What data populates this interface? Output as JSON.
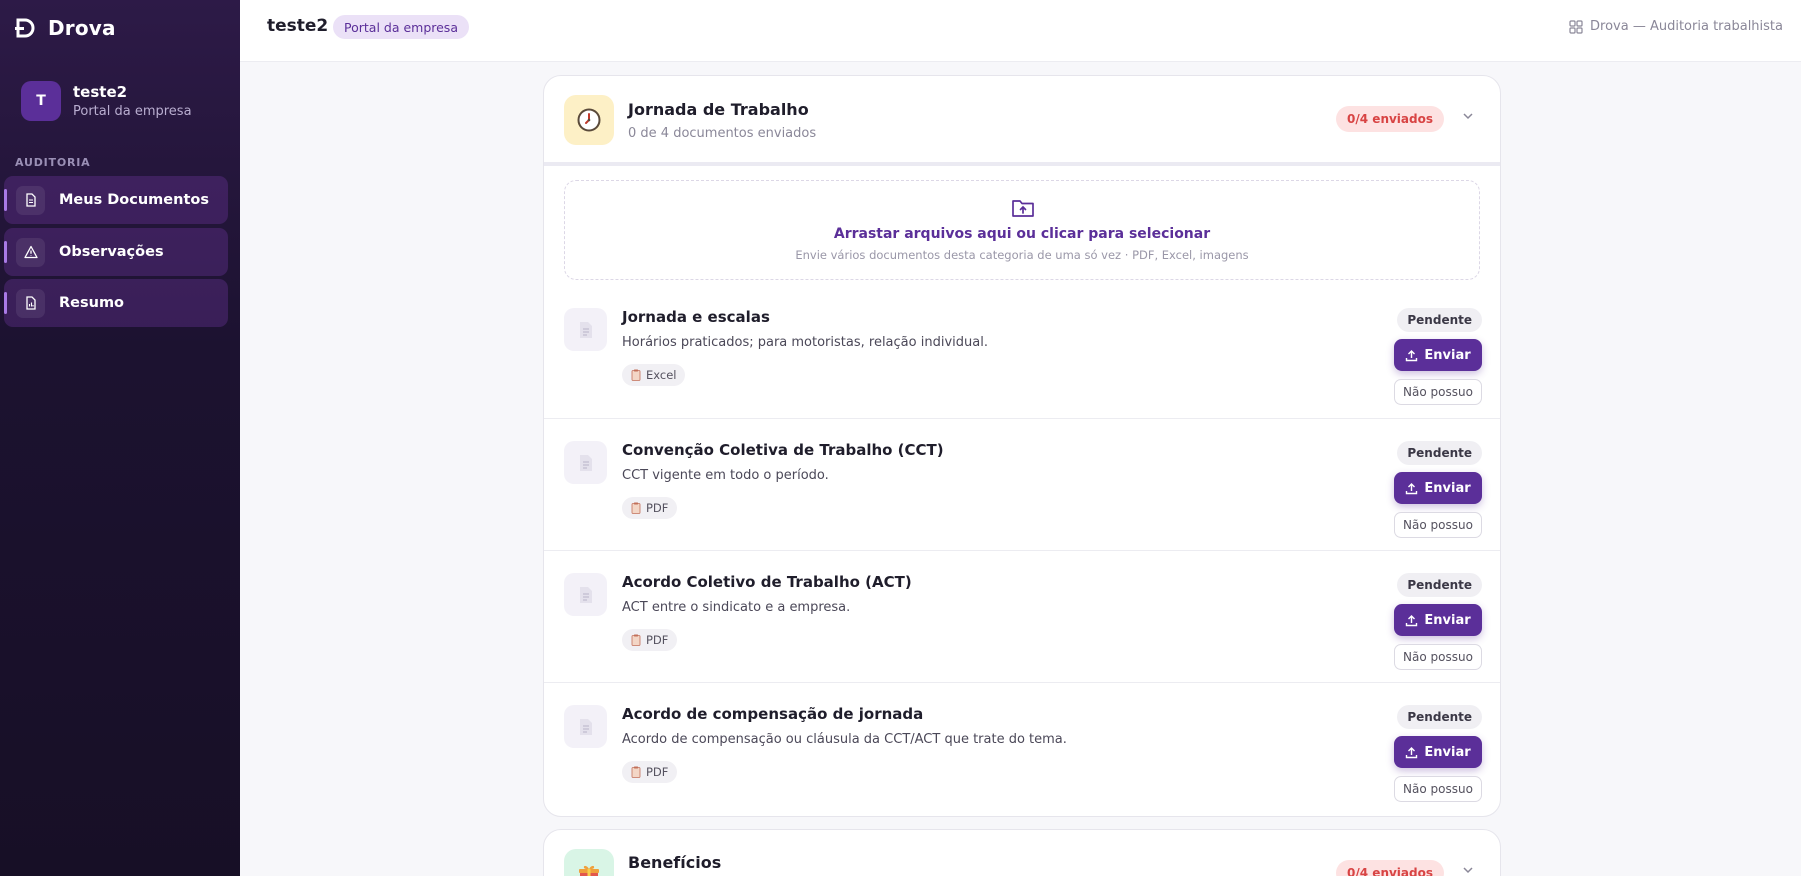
{
  "app": {
    "brand": "Drova"
  },
  "user": {
    "initial": "T",
    "name": "teste2",
    "subtitle": "Portal da empresa"
  },
  "sidebar": {
    "section_label": "AUDITORIA",
    "items": [
      {
        "label": "Meus Documentos",
        "icon": "document-icon"
      },
      {
        "label": "Observações",
        "icon": "warning-icon"
      },
      {
        "label": "Resumo",
        "icon": "report-icon"
      }
    ]
  },
  "header": {
    "title": "teste2",
    "badge": "Portal da empresa",
    "right_label": "Drova — Auditoria trabalhista"
  },
  "category": {
    "icon": "clock-icon",
    "title": "Jornada de Trabalho",
    "subtitle": "0 de 4 documentos enviados",
    "count_badge": "0/4 enviados",
    "dropzone": {
      "title": "Arrastar arquivos aqui ou clicar para selecionar",
      "subtitle": "Envie vários documentos desta categoria de uma só vez · PDF, Excel, imagens"
    },
    "documents": [
      {
        "title": "Jornada e escalas",
        "description": "Horários praticados; para motoristas, relação individual.",
        "type": "Excel",
        "status": "Pendente",
        "send_label": "Enviar",
        "cannot_label": "Não possuo"
      },
      {
        "title": "Convenção Coletiva de Trabalho (CCT)",
        "description": "CCT vigente em todo o período.",
        "type": "PDF",
        "status": "Pendente",
        "send_label": "Enviar",
        "cannot_label": "Não possuo"
      },
      {
        "title": "Acordo Coletivo de Trabalho (ACT)",
        "description": "ACT entre o sindicato e a empresa.",
        "type": "PDF",
        "status": "Pendente",
        "send_label": "Enviar",
        "cannot_label": "Não possuo"
      },
      {
        "title": "Acordo de compensação de jornada",
        "description": "Acordo de compensação ou cláusula da CCT/ACT que trate do tema.",
        "type": "PDF",
        "status": "Pendente",
        "send_label": "Enviar",
        "cannot_label": "Não possuo"
      }
    ]
  },
  "category2": {
    "icon": "gift-icon",
    "title": "Benefícios",
    "count_badge": "0/4 enviados"
  },
  "colors": {
    "primary": "#5b2f99",
    "sidebar_bg": "#1c1230",
    "danger": "#d84444",
    "badge_bg": "#ebe1f7"
  }
}
